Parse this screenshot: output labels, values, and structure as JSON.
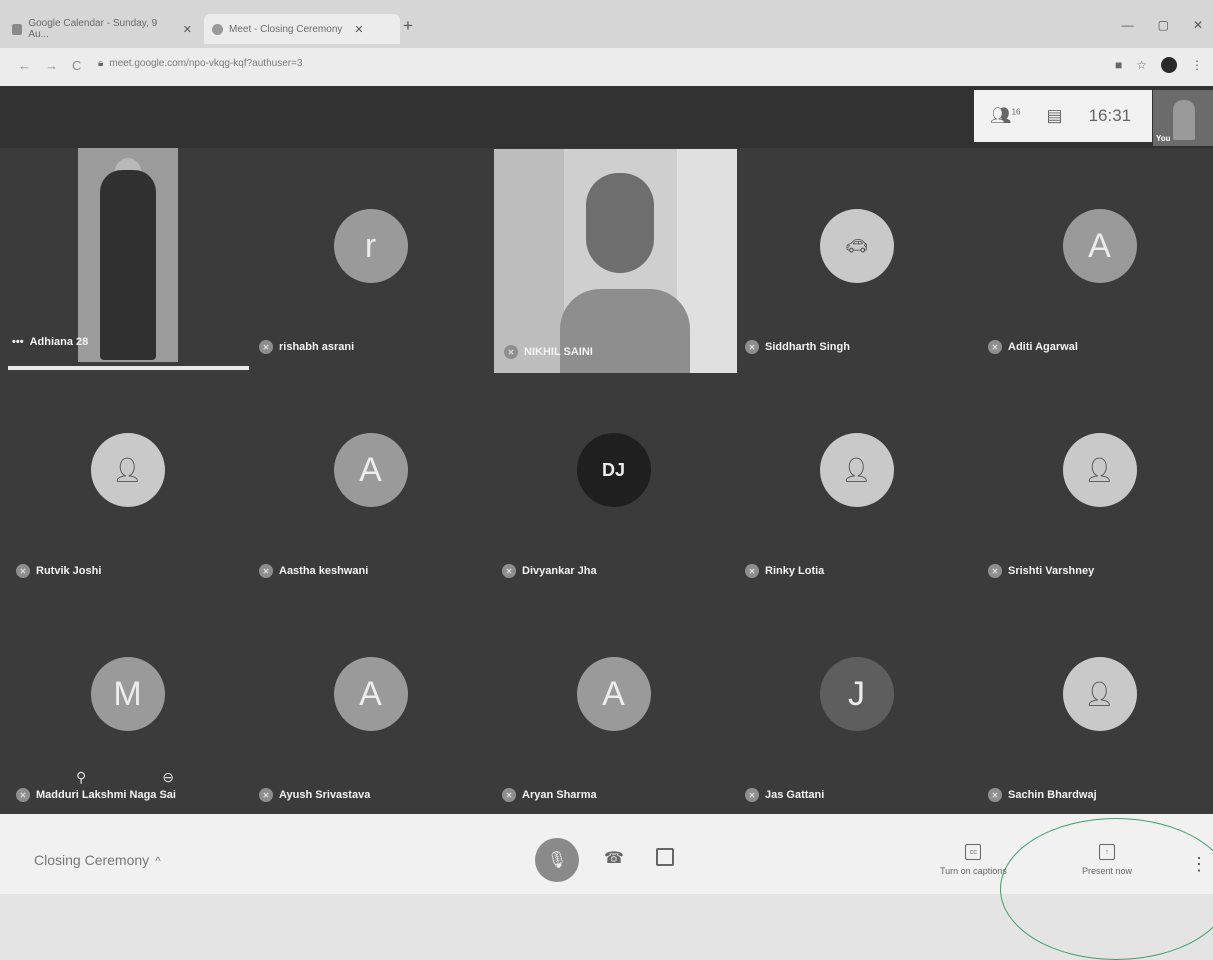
{
  "browser": {
    "tabs": [
      {
        "label": "Google Calendar - Sunday, 9 Au..."
      },
      {
        "label": "Meet - Closing Ceremony"
      }
    ],
    "url": "meet.google.com/npo-vkqg-kqf?authuser=3"
  },
  "meet": {
    "topbar": {
      "participant_count": "16",
      "time": "16:31",
      "self_label": "You"
    },
    "participants": [
      {
        "name": "Adhiana 28"
      },
      {
        "name": "rishabh asrani",
        "initial": "r"
      },
      {
        "name": "NIKHIL SAINI"
      },
      {
        "name": "Siddharth Singh"
      },
      {
        "name": "Aditi Agarwal",
        "initial": "A"
      },
      {
        "name": "Rutvik Joshi"
      },
      {
        "name": "Aastha keshwani",
        "initial": "A"
      },
      {
        "name": "Divyankar Jha",
        "avatar_text": "DJ"
      },
      {
        "name": "Rinky Lotia"
      },
      {
        "name": "Srishti Varshney"
      },
      {
        "name": "Madduri Lakshmi Naga Sai",
        "initial": "M"
      },
      {
        "name": "Ayush Srivastava",
        "initial": "A"
      },
      {
        "name": "Aryan Sharma",
        "initial": "A"
      },
      {
        "name": "Jas Gattani",
        "initial": "J"
      },
      {
        "name": "Sachin Bhardwaj"
      }
    ],
    "bottombar": {
      "meeting_title": "Closing Ceremony",
      "captions_label": "Turn on captions",
      "present_label": "Present now"
    }
  }
}
